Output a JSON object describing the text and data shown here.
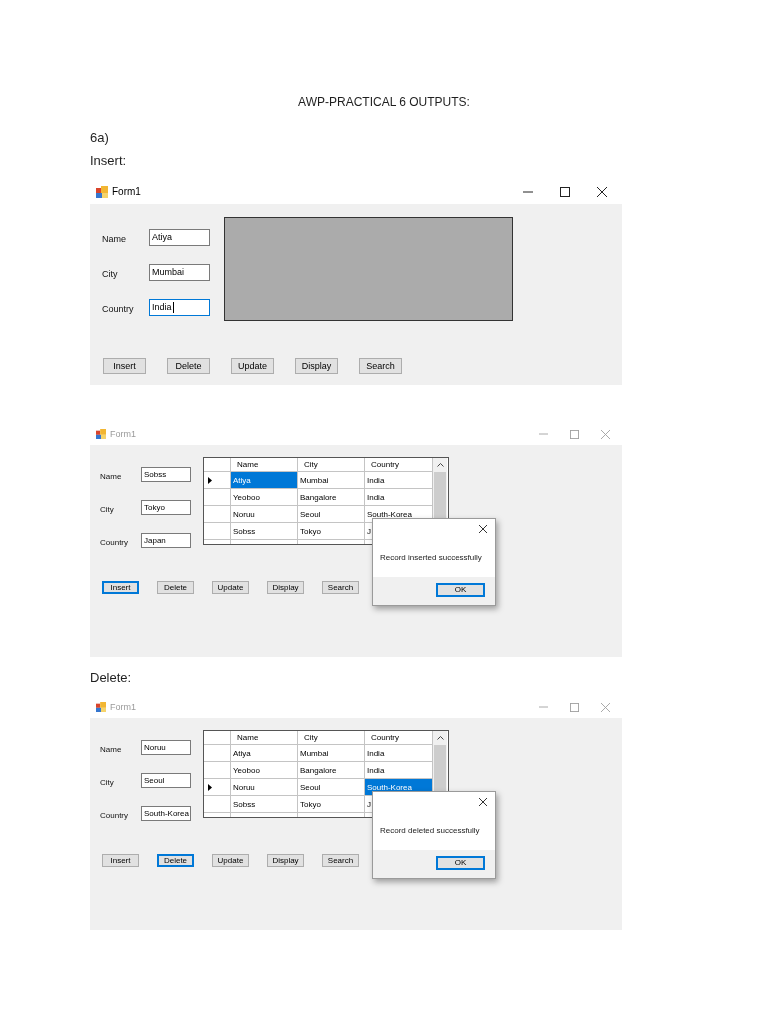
{
  "heading": "AWP-PRACTICAL 6 OUTPUTS:",
  "section": "6a)",
  "outputs": [
    {
      "caption": "Insert:",
      "window": {
        "title": "Form1",
        "active": true,
        "fields": [
          {
            "label": "Name",
            "value": "Atiya",
            "focused": false
          },
          {
            "label": "City",
            "value": "Mumbai",
            "focused": false
          },
          {
            "label": "Country",
            "value": "India",
            "focused": true
          }
        ],
        "display": {
          "kind": "panel"
        },
        "buttons": [
          {
            "label": "Insert",
            "focused": false
          },
          {
            "label": "Delete",
            "focused": false
          },
          {
            "label": "Update",
            "focused": false
          },
          {
            "label": "Display",
            "focused": false
          },
          {
            "label": "Search",
            "focused": false
          }
        ]
      }
    },
    {
      "window": {
        "title": "Form1",
        "active": false,
        "fields": [
          {
            "label": "Name",
            "value": "Sobss",
            "focused": false
          },
          {
            "label": "City",
            "value": "Tokyo",
            "focused": false
          },
          {
            "label": "Country",
            "value": "Japan",
            "focused": false
          }
        ],
        "display": {
          "kind": "grid",
          "columns": [
            "Name",
            "City",
            "Country"
          ],
          "rows": [
            {
              "current": true,
              "cells": [
                {
                  "text": "Atiya",
                  "selected": true
                },
                {
                  "text": "Mumbai",
                  "selected": false
                },
                {
                  "text": "India",
                  "selected": false
                }
              ]
            },
            {
              "current": false,
              "cells": [
                {
                  "text": "Yeoboo",
                  "selected": false
                },
                {
                  "text": "Bangalore",
                  "selected": false
                },
                {
                  "text": "India",
                  "selected": false
                }
              ]
            },
            {
              "current": false,
              "cells": [
                {
                  "text": "Noruu",
                  "selected": false
                },
                {
                  "text": "Seoul",
                  "selected": false
                },
                {
                  "text": "South-Korea",
                  "selected": false
                }
              ]
            },
            {
              "current": false,
              "cells": [
                {
                  "text": "Sobss",
                  "selected": false
                },
                {
                  "text": "Tokyo",
                  "selected": false
                },
                {
                  "text": "J",
                  "selected": false
                }
              ]
            }
          ]
        },
        "buttons": [
          {
            "label": "Insert",
            "focused": true
          },
          {
            "label": "Delete",
            "focused": false
          },
          {
            "label": "Update",
            "focused": false
          },
          {
            "label": "Display",
            "focused": false
          },
          {
            "label": "Search",
            "focused": false
          }
        ],
        "dialog": {
          "message": "Record inserted successfully",
          "button": "OK"
        }
      }
    },
    {
      "caption": "Delete:",
      "window": {
        "title": "Form1",
        "active": false,
        "fields": [
          {
            "label": "Name",
            "value": "Noruu",
            "focused": false
          },
          {
            "label": "City",
            "value": "Seoul",
            "focused": false
          },
          {
            "label": "Country",
            "value": "South-Korea",
            "focused": false
          }
        ],
        "display": {
          "kind": "grid",
          "columns": [
            "Name",
            "City",
            "Country"
          ],
          "rows": [
            {
              "current": false,
              "cells": [
                {
                  "text": "Atiya",
                  "selected": false
                },
                {
                  "text": "Mumbai",
                  "selected": false
                },
                {
                  "text": "India",
                  "selected": false
                }
              ]
            },
            {
              "current": false,
              "cells": [
                {
                  "text": "Yeoboo",
                  "selected": false
                },
                {
                  "text": "Bangalore",
                  "selected": false
                },
                {
                  "text": "India",
                  "selected": false
                }
              ]
            },
            {
              "current": true,
              "cells": [
                {
                  "text": "Noruu",
                  "selected": false
                },
                {
                  "text": "Seoul",
                  "selected": false
                },
                {
                  "text": "South-Korea",
                  "selected": true
                }
              ]
            },
            {
              "current": false,
              "cells": [
                {
                  "text": "Sobss",
                  "selected": false
                },
                {
                  "text": "Tokyo",
                  "selected": false
                },
                {
                  "text": "J",
                  "selected": false
                }
              ]
            }
          ]
        },
        "buttons": [
          {
            "label": "Insert",
            "focused": false
          },
          {
            "label": "Delete",
            "focused": true
          },
          {
            "label": "Update",
            "focused": false
          },
          {
            "label": "Display",
            "focused": false
          },
          {
            "label": "Search",
            "focused": false
          }
        ],
        "dialog": {
          "message": "Record deleted successfully",
          "button": "OK"
        }
      }
    }
  ]
}
